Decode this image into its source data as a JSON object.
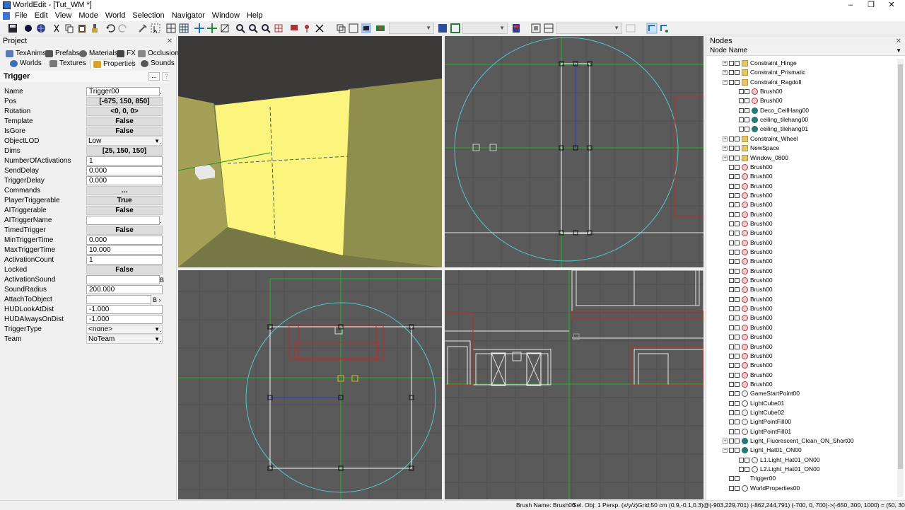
{
  "window": {
    "title": "WorldEdit - [Tut_WM *]",
    "minimize": "–",
    "maximize": "❐",
    "close": "✕"
  },
  "menu": [
    "File",
    "Edit",
    "View",
    "Mode",
    "World",
    "Selection",
    "Navigator",
    "Window",
    "Help"
  ],
  "project": {
    "title": "Project",
    "close": "✕",
    "tabs_row1": [
      "TexAnims",
      "Prefabs",
      "Materials",
      "FX",
      "Occlusion"
    ],
    "tabs_row2": [
      "Worlds",
      "Textures",
      "Properties",
      "Sounds"
    ],
    "active_tab": "Properties",
    "object_type": "Trigger",
    "header_btn": "...",
    "help_btn": "?"
  },
  "properties": [
    {
      "label": "Name",
      "value": "Trigger00",
      "kind": "text",
      "extra": "."
    },
    {
      "label": "Pos",
      "value": "[-675, 150, 850]",
      "kind": "btn"
    },
    {
      "label": "Rotation",
      "value": "<0, 0, 0>",
      "kind": "btn"
    },
    {
      "label": "Template",
      "value": "False",
      "kind": "btn"
    },
    {
      "label": "IsGore",
      "value": "False",
      "kind": "btn"
    },
    {
      "label": "ObjectLOD",
      "value": "Low",
      "kind": "combo",
      "extra": "."
    },
    {
      "label": "Dims",
      "value": "[25, 150, 150]",
      "kind": "btn"
    },
    {
      "label": "NumberOfActivations",
      "value": "1",
      "kind": "text"
    },
    {
      "label": "SendDelay",
      "value": "0.000",
      "kind": "text"
    },
    {
      "label": "TriggerDelay",
      "value": "0.000",
      "kind": "text"
    },
    {
      "label": "Commands",
      "value": "...",
      "kind": "btn"
    },
    {
      "label": "PlayerTriggerable",
      "value": "True",
      "kind": "btn"
    },
    {
      "label": "AITriggerable",
      "value": "False",
      "kind": "btn"
    },
    {
      "label": "AITriggerName",
      "value": "",
      "kind": "text",
      "extra": "."
    },
    {
      "label": "TimedTrigger",
      "value": "False",
      "kind": "btn"
    },
    {
      "label": "MinTriggerTime",
      "value": "0.000",
      "kind": "text"
    },
    {
      "label": "MaxTriggerTime",
      "value": "10.000",
      "kind": "text"
    },
    {
      "label": "ActivationCount",
      "value": "1",
      "kind": "text"
    },
    {
      "label": "Locked",
      "value": "False",
      "kind": "btn"
    },
    {
      "label": "ActivationSound",
      "value": "",
      "kind": "text",
      "extra": "B"
    },
    {
      "label": "SoundRadius",
      "value": "200.000",
      "kind": "text"
    },
    {
      "label": "AttachToObject",
      "value": "",
      "kind": "text",
      "extra": "B ›"
    },
    {
      "label": "HUDLookAtDist",
      "value": "-1.000",
      "kind": "text"
    },
    {
      "label": "HUDAlwaysOnDist",
      "value": "-1.000",
      "kind": "text"
    },
    {
      "label": "TriggerType",
      "value": "<none>",
      "kind": "combo",
      "extra": "."
    },
    {
      "label": "Team",
      "value": "NoTeam",
      "kind": "combo",
      "extra": "."
    }
  ],
  "nodes": {
    "title": "Nodes",
    "close": "✕",
    "column": "Node Name",
    "items": [
      {
        "name": "Constraint_Hinge",
        "icon": "folder",
        "depth": 1,
        "exp": "+"
      },
      {
        "name": "Constraint_Prismatic",
        "icon": "folder",
        "depth": 1,
        "exp": "+"
      },
      {
        "name": "Constraint_Ragdoll",
        "icon": "folder",
        "depth": 1,
        "exp": "−"
      },
      {
        "name": "Brush00",
        "icon": "brush",
        "depth": 2
      },
      {
        "name": "Brush00",
        "icon": "brush",
        "depth": 2
      },
      {
        "name": "Deco_CeilHang00",
        "icon": "mesh",
        "depth": 2
      },
      {
        "name": "ceiling_tilehang00",
        "icon": "mesh",
        "depth": 2
      },
      {
        "name": "ceiling_tilehang01",
        "icon": "mesh",
        "depth": 2
      },
      {
        "name": "Constraint_Wheel",
        "icon": "folder",
        "depth": 1,
        "exp": "+"
      },
      {
        "name": "NewSpace",
        "icon": "folder",
        "depth": 1,
        "exp": "+"
      },
      {
        "name": "Window_0800",
        "icon": "folder",
        "depth": 1,
        "exp": "+"
      },
      {
        "name": "Brush00",
        "icon": "brush",
        "depth": 1
      },
      {
        "name": "Brush00",
        "icon": "brush",
        "depth": 1
      },
      {
        "name": "Brush00",
        "icon": "brush",
        "depth": 1
      },
      {
        "name": "Brush00",
        "icon": "brush",
        "depth": 1
      },
      {
        "name": "Brush00",
        "icon": "brush",
        "depth": 1
      },
      {
        "name": "Brush00",
        "icon": "brush",
        "depth": 1
      },
      {
        "name": "Brush00",
        "icon": "brush",
        "depth": 1
      },
      {
        "name": "Brush00",
        "icon": "brush",
        "depth": 1
      },
      {
        "name": "Brush00",
        "icon": "brush",
        "depth": 1
      },
      {
        "name": "Brush00",
        "icon": "brush",
        "depth": 1
      },
      {
        "name": "Brush00",
        "icon": "brush",
        "depth": 1
      },
      {
        "name": "Brush00",
        "icon": "brush",
        "depth": 1
      },
      {
        "name": "Brush00",
        "icon": "brush",
        "depth": 1
      },
      {
        "name": "Brush00",
        "icon": "brush",
        "depth": 1
      },
      {
        "name": "Brush00",
        "icon": "brush",
        "depth": 1
      },
      {
        "name": "Brush00",
        "icon": "brush",
        "depth": 1
      },
      {
        "name": "Brush00",
        "icon": "brush",
        "depth": 1
      },
      {
        "name": "Brush00",
        "icon": "brush",
        "depth": 1
      },
      {
        "name": "Brush00",
        "icon": "brush",
        "depth": 1
      },
      {
        "name": "Brush00",
        "icon": "brush",
        "depth": 1
      },
      {
        "name": "Brush00",
        "icon": "brush",
        "depth": 1
      },
      {
        "name": "Brush00",
        "icon": "brush",
        "depth": 1
      },
      {
        "name": "Brush00",
        "icon": "brush",
        "depth": 1
      },
      {
        "name": "Brush00",
        "icon": "brush",
        "depth": 1
      },
      {
        "name": "GameStartPoint00",
        "icon": "light",
        "depth": 1
      },
      {
        "name": "LightCube01",
        "icon": "light",
        "depth": 1
      },
      {
        "name": "LightCube02",
        "icon": "light",
        "depth": 1
      },
      {
        "name": "LightPointFill00",
        "icon": "light",
        "depth": 1
      },
      {
        "name": "LightPointFill01",
        "icon": "light",
        "depth": 1
      },
      {
        "name": "Light_Fluorescent_Clean_ON_Short00",
        "icon": "mesh",
        "depth": 1,
        "exp": "+"
      },
      {
        "name": "Light_Hat01_ON00",
        "icon": "mesh",
        "depth": 1,
        "exp": "−"
      },
      {
        "name": "L1.Light_Hat01_ON00",
        "icon": "light",
        "depth": 2
      },
      {
        "name": "L2.Light_Hat01_ON00",
        "icon": "light",
        "depth": 2
      },
      {
        "name": "Trigger00",
        "icon": "trigger",
        "depth": 1
      },
      {
        "name": "WorldProperties00",
        "icon": "light",
        "depth": 1
      }
    ]
  },
  "status": {
    "brush_name": "Brush Name: Brush00",
    "sel_obj": "Sel. Obj: 1",
    "projection": "Persp. (x/y/z)",
    "grid": "Grid:50 cm",
    "coords": "(0.9,-0.1,0.3)@(-903,229,701)   (-862,244,791)   (-700, 0, 700)->(-650, 300, 1000) = (50, 300, 300)"
  },
  "colors": {
    "trigger_yellow": "#fbf57e",
    "grid_green": "#22b422",
    "radius_cyan": "#4fc9c9",
    "brush_red": "#c02a2a",
    "viewport_bg": "#5a5a5a"
  }
}
